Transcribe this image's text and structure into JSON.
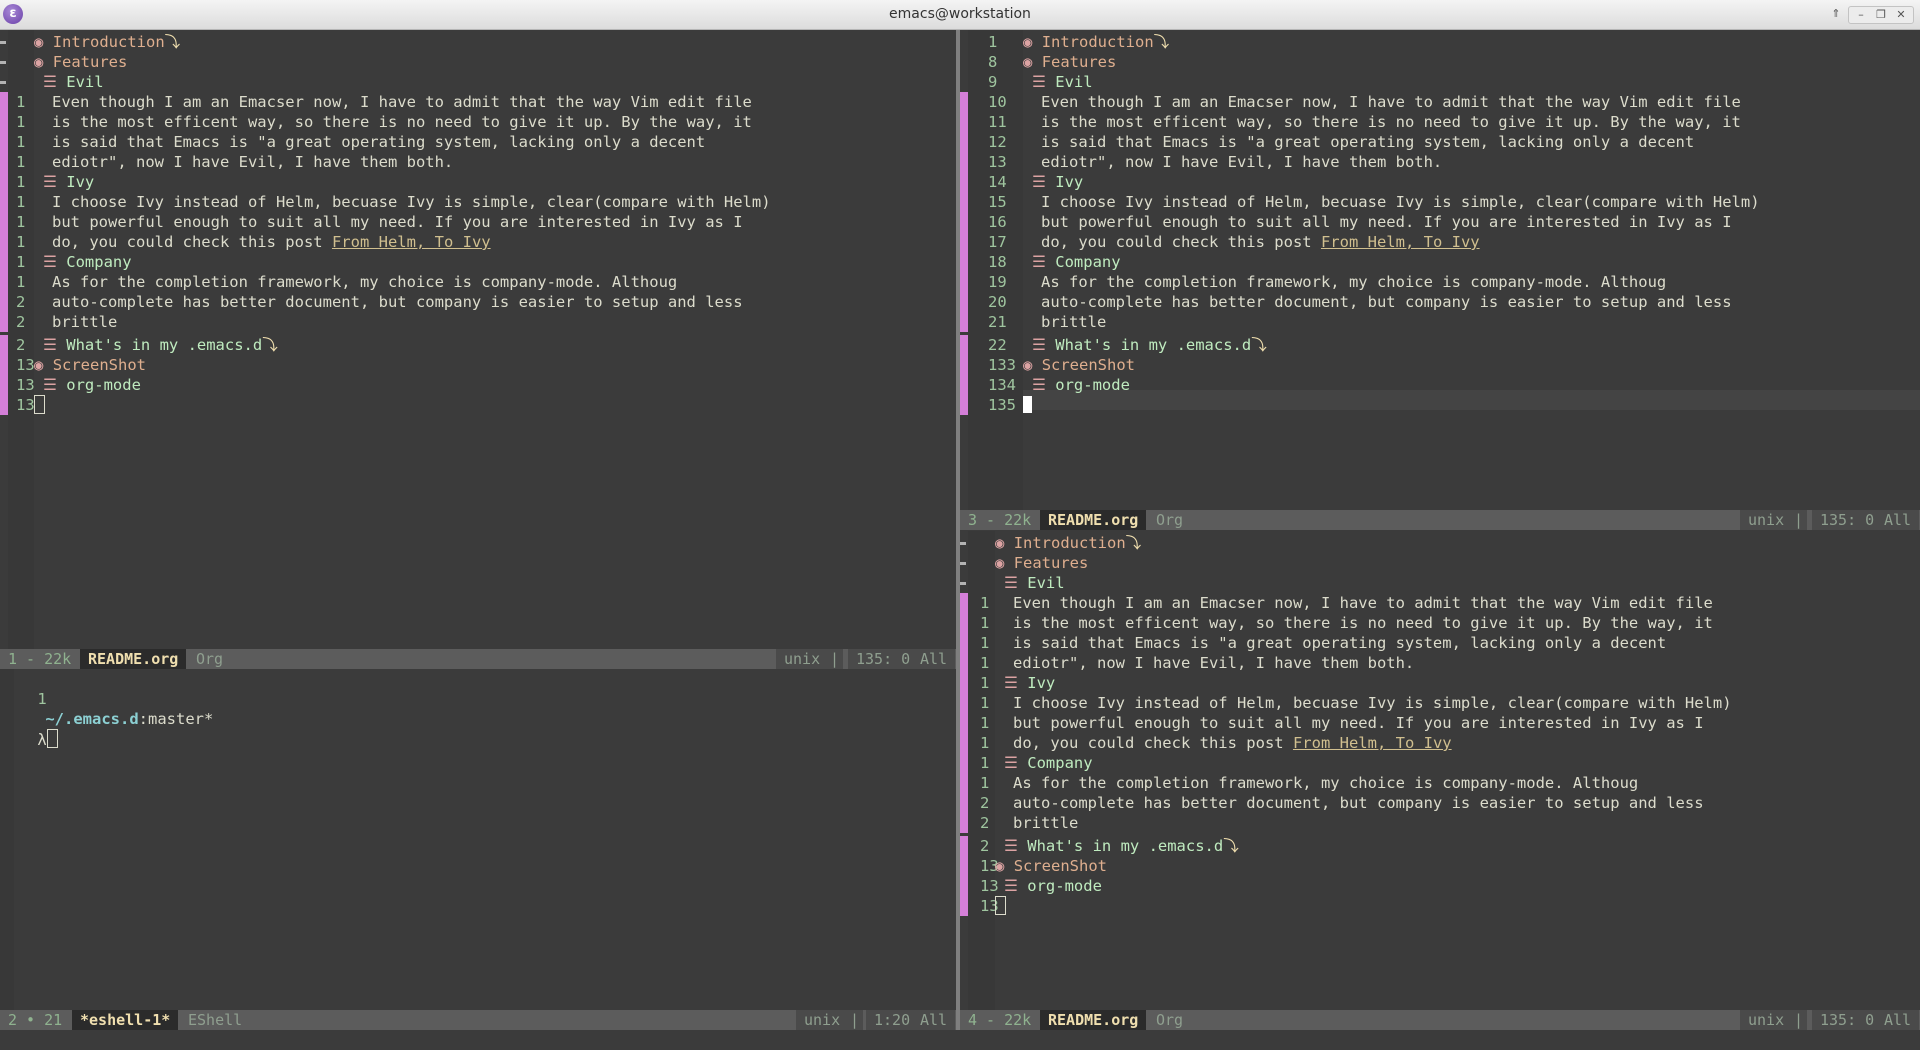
{
  "titlebar": {
    "title": "emacs@workstation",
    "app_glyph": "ε"
  },
  "outline": [
    {
      "type": "h1",
      "bullet": "◉",
      "text": "Introduction",
      "ellipsis": "⤵"
    },
    {
      "type": "h1",
      "bullet": "◉",
      "text": "Features"
    },
    {
      "type": "h2",
      "bullet": "☰",
      "text": "Evil"
    },
    {
      "type": "text",
      "text": "Even though I am an Emacser now, I have to admit that the way Vim edit file"
    },
    {
      "type": "text",
      "text": "is the most efficent way, so there is no need to give it up. By the way, it"
    },
    {
      "type": "text",
      "text": "is said that Emacs is \"a great operating system, lacking only a decent"
    },
    {
      "type": "text",
      "text": "ediotr\", now I have Evil, I have them both."
    },
    {
      "type": "h2",
      "bullet": "☰",
      "text": "Ivy"
    },
    {
      "type": "text",
      "text": "I choose Ivy instead of Helm, becuase Ivy is simple, clear(compare with Helm)"
    },
    {
      "type": "text",
      "text": "but powerful enough to suit all my need. If you are interested in Ivy as I"
    },
    {
      "type": "text",
      "text": "do, you could check this post ",
      "link": "From Helm, To Ivy"
    },
    {
      "type": "h2",
      "bullet": "☰",
      "text": "Company"
    },
    {
      "type": "text",
      "text": "As for the completion framework, my choice is company-mode. Althoug"
    },
    {
      "type": "text",
      "text": "auto-complete has better document, but company is easier to setup and less"
    },
    {
      "type": "text",
      "text": "brittle"
    },
    {
      "type": "h2",
      "bullet": "☰",
      "text": "What's in my .emacs.d",
      "ellipsis": "⤵",
      "gap": true
    },
    {
      "type": "h1",
      "bullet": "◉",
      "text": "ScreenShot"
    },
    {
      "type": "h2",
      "bullet": "☰",
      "text": "org-mode"
    },
    {
      "type": "cursor"
    }
  ],
  "windows": {
    "topleft": {
      "linenums": [
        "",
        "",
        "",
        "1",
        "1",
        "1",
        "1",
        "1",
        "1",
        "1",
        "1",
        "1",
        "1",
        "2",
        "2",
        "2",
        "13",
        "13",
        "13"
      ]
    },
    "topright": {
      "linenums": [
        "1",
        "8",
        "9",
        "10",
        "11",
        "12",
        "13",
        "14",
        "15",
        "16",
        "17",
        "18",
        "19",
        "20",
        "21",
        "22",
        "133",
        "134",
        "135"
      ]
    },
    "botright": {
      "linenums": [
        "",
        "",
        "",
        "1",
        "1",
        "1",
        "1",
        "1",
        "1",
        "1",
        "1",
        "1",
        "1",
        "2",
        "2",
        "2",
        "13",
        "13",
        "13"
      ]
    }
  },
  "modelines": {
    "topleft": {
      "num": "1 - 22k",
      "buffer": "README.org",
      "mode": "Org",
      "eol": "unix",
      "pos": "135: 0",
      "scroll": "All"
    },
    "topright": {
      "num": "3 - 22k",
      "buffer": "README.org",
      "mode": "Org",
      "eol": "unix",
      "pos": "135: 0",
      "scroll": "All"
    },
    "botleft": {
      "num": "2 • 21",
      "buffer": "*eshell-1*",
      "mode": "EShell",
      "eol": "unix",
      "pos": "1:20",
      "scroll": "All"
    },
    "botright": {
      "num": "4 - 22k",
      "buffer": "README.org",
      "mode": "Org",
      "eol": "unix",
      "pos": "135: 0",
      "scroll": "All"
    }
  },
  "eshell": {
    "linenum": "1",
    "path": "~/.emacs.d",
    "sep": ":",
    "branch": "master*",
    "prompt": "λ"
  }
}
